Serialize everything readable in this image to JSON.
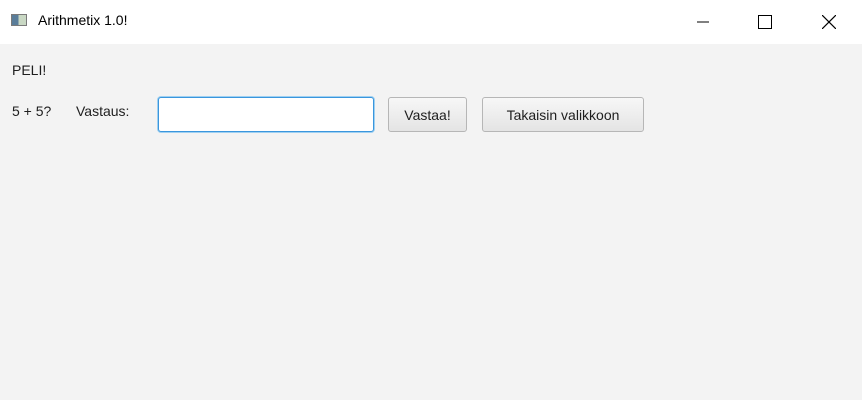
{
  "window": {
    "title": "Arithmetix 1.0!",
    "icons": {
      "app": "app-icon",
      "minimize": "minimize-icon",
      "maximize": "maximize-icon",
      "close": "close-icon"
    }
  },
  "game": {
    "heading": "PELI!",
    "question": "5 + 5?",
    "answer_label": "Vastaus:",
    "answer_value": "",
    "answer_placeholder": "",
    "submit_label": "Vastaa!",
    "back_label": "Takaisin valikkoon"
  },
  "colors": {
    "focus_border": "#3a96dd",
    "background": "#f3f3f3",
    "titlebar": "#ffffff"
  }
}
